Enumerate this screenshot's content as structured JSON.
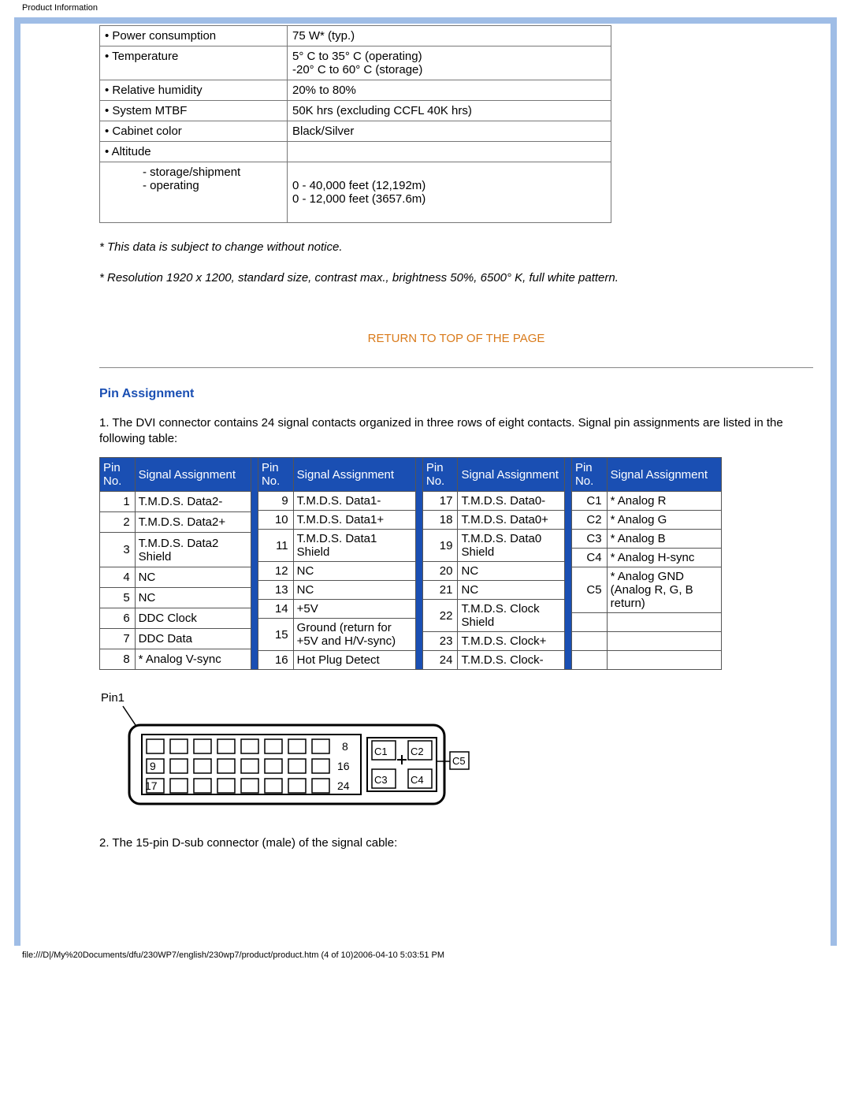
{
  "header_text": "Product Information",
  "spec_rows": [
    {
      "label": "• Power consumption",
      "value": "75 W* (typ.)"
    },
    {
      "label": "• Temperature",
      "value": "5° C to 35° C (operating)\n-20° C to 60° C (storage)"
    },
    {
      "label": "• Relative humidity",
      "value": "20% to 80%"
    },
    {
      "label": "• System MTBF",
      "value": "50K hrs (excluding CCFL 40K hrs)"
    },
    {
      "label": "• Cabinet color",
      "value": "Black/Silver"
    },
    {
      "label": "• Altitude",
      "value": ""
    }
  ],
  "altitude_sub_label": "- storage/shipment\n- operating",
  "altitude_sub_value": "0 - 40,000 feet (12,192m)\n0 - 12,000 feet (3657.6m)",
  "note1": "* This data is subject to change without notice.",
  "note2": "* Resolution 1920 x 1200, standard size, contrast max., brightness 50%, 6500° K, full white pattern.",
  "return_link": "RETURN TO TOP OF THE PAGE",
  "section_title": "Pin Assignment",
  "pin_intro": "1. The DVI connector contains 24 signal contacts organized in three rows of eight contacts. Signal pin assignments are listed in the following table:",
  "pin_header_pin": "Pin No.",
  "pin_header_sig": "Signal Assignment",
  "pin_groups": [
    {
      "rows": [
        {
          "pin": "1",
          "sig": "T.M.D.S. Data2-"
        },
        {
          "pin": "2",
          "sig": "T.M.D.S. Data2+"
        },
        {
          "pin": "3",
          "sig": "T.M.D.S. Data2 Shield"
        },
        {
          "pin": "4",
          "sig": "NC"
        },
        {
          "pin": "5",
          "sig": "NC"
        },
        {
          "pin": "6",
          "sig": "DDC Clock"
        },
        {
          "pin": "7",
          "sig": "DDC Data"
        },
        {
          "pin": "8",
          "sig": "* Analog V-sync"
        }
      ],
      "sigw": 140
    },
    {
      "rows": [
        {
          "pin": "9",
          "sig": "T.M.D.S. Data1-"
        },
        {
          "pin": "10",
          "sig": "T.M.D.S. Data1+"
        },
        {
          "pin": "11",
          "sig": "T.M.D.S. Data1 Shield"
        },
        {
          "pin": "12",
          "sig": "NC"
        },
        {
          "pin": "13",
          "sig": "NC"
        },
        {
          "pin": "14",
          "sig": "+5V"
        },
        {
          "pin": "15",
          "sig": "Ground (return for +5V and H/V-sync)"
        },
        {
          "pin": "16",
          "sig": "Hot Plug Detect"
        }
      ],
      "sigw": 148
    },
    {
      "rows": [
        {
          "pin": "17",
          "sig": "T.M.D.S. Data0-"
        },
        {
          "pin": "18",
          "sig": "T.M.D.S. Data0+"
        },
        {
          "pin": "19",
          "sig": "T.M.D.S. Data0 Shield"
        },
        {
          "pin": "20",
          "sig": "NC"
        },
        {
          "pin": "21",
          "sig": "NC"
        },
        {
          "pin": "22",
          "sig": "T.M.D.S. Clock Shield"
        },
        {
          "pin": "23",
          "sig": "T.M.D.S. Clock+"
        },
        {
          "pin": "24",
          "sig": "T.M.D.S. Clock-"
        }
      ],
      "sigw": 128
    },
    {
      "rows": [
        {
          "pin": "C1",
          "sig": "* Analog R"
        },
        {
          "pin": "C2",
          "sig": "* Analog G"
        },
        {
          "pin": "C3",
          "sig": "* Analog B"
        },
        {
          "pin": "C4",
          "sig": "* Analog H-sync"
        },
        {
          "pin": "C5",
          "sig": "* Analog GND (Analog R, G, B return)"
        },
        {
          "pin": "",
          "sig": ""
        },
        {
          "pin": "",
          "sig": ""
        },
        {
          "pin": "",
          "sig": ""
        }
      ],
      "sigw": 138
    }
  ],
  "diagram_labels": {
    "pin1": "Pin1",
    "r1": "8",
    "r2": "16",
    "r3": "24",
    "l2": "9",
    "l3": "17",
    "c1": "C1",
    "c2": "C2",
    "c3": "C3",
    "c4": "C4",
    "c5": "C5"
  },
  "dsub_intro": "2. The 15-pin D-sub connector (male) of the signal cable:",
  "footer": "file:///D|/My%20Documents/dfu/230WP7/english/230wp7/product/product.htm (4 of 10)2006-04-10 5:03:51 PM"
}
